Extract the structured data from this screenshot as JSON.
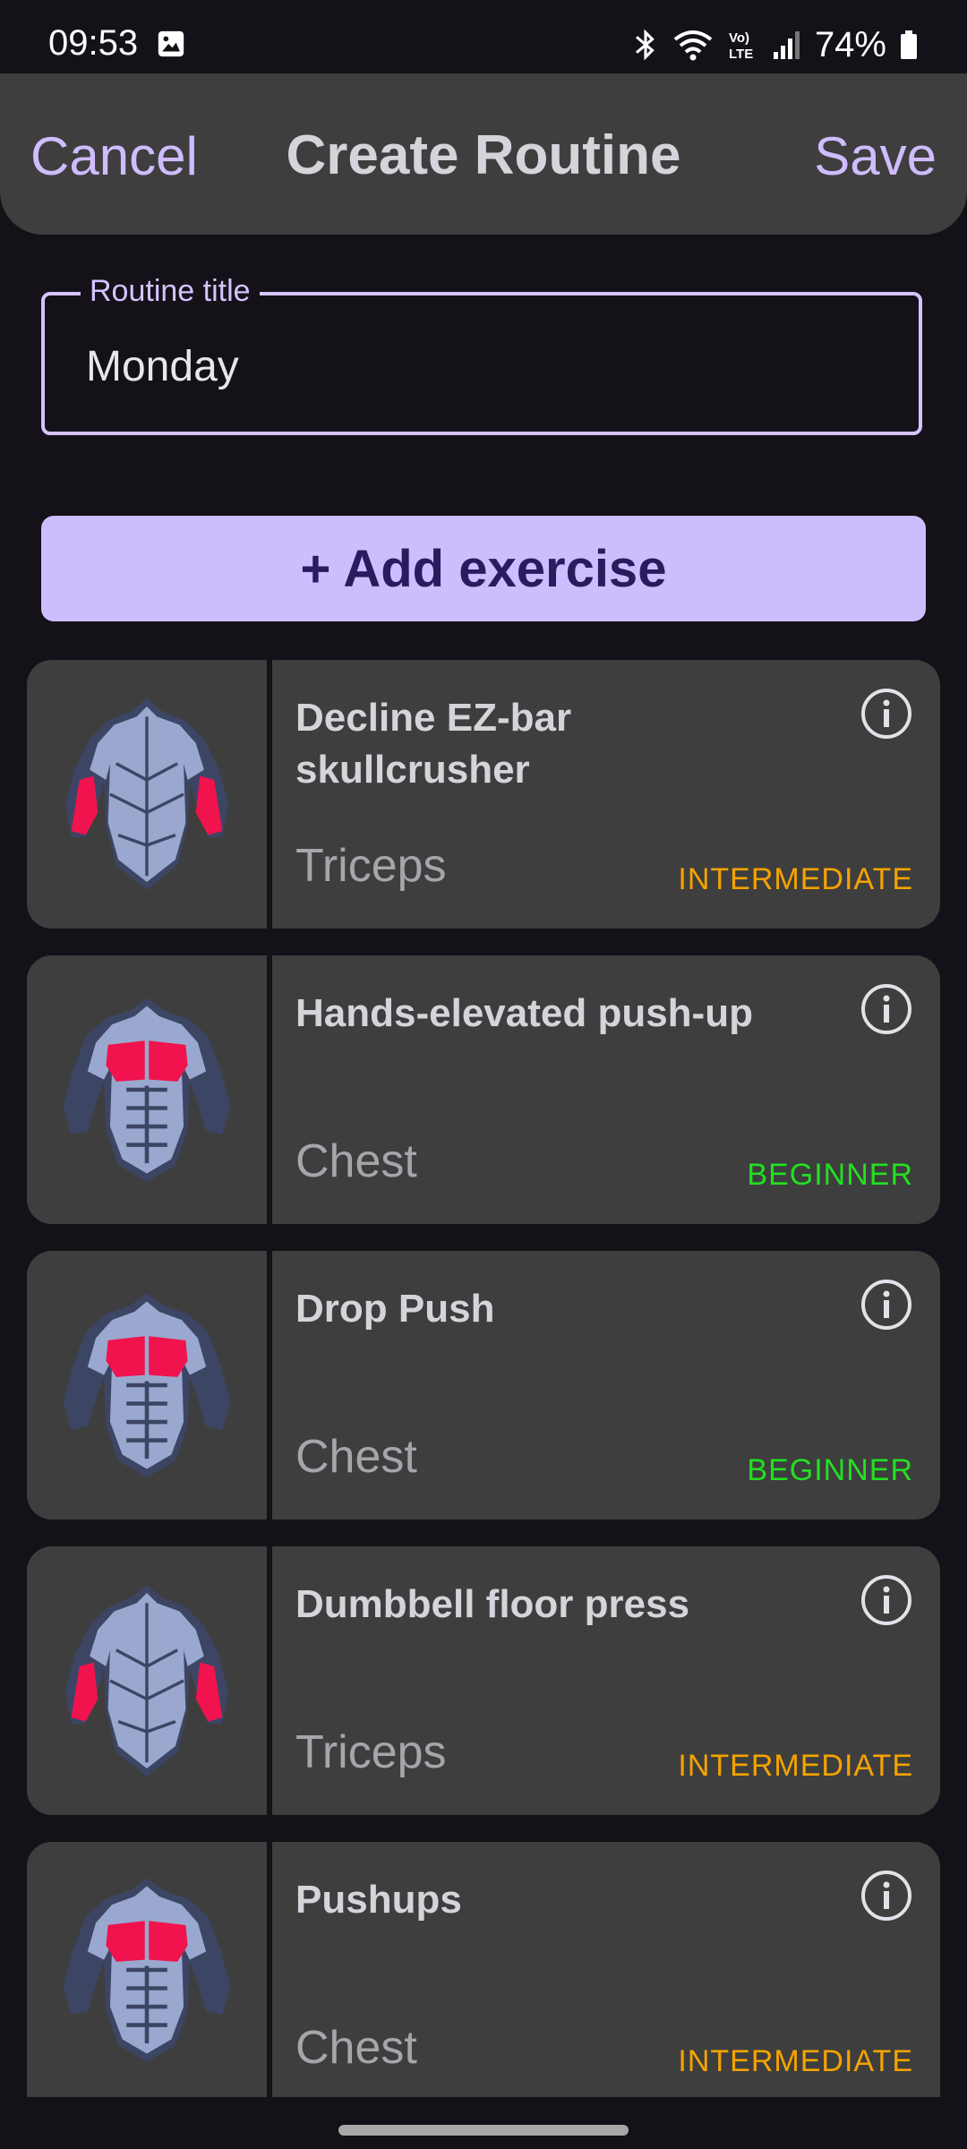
{
  "status_bar": {
    "time": "09:53",
    "battery": "74%",
    "icons": [
      "photo-icon",
      "bluetooth-icon",
      "wifi-icon",
      "volte-icon",
      "signal-icon",
      "battery-icon"
    ]
  },
  "appbar": {
    "cancel_label": "Cancel",
    "title": "Create Routine",
    "save_label": "Save"
  },
  "routine_field": {
    "label": "Routine title",
    "value": "Monday"
  },
  "add_button": {
    "label": "+ Add exercise"
  },
  "exercises": [
    {
      "name": "Decline EZ-bar skullcrusher",
      "muscle": "Triceps",
      "level": "INTERMEDIATE",
      "image": "back-triceps-icon"
    },
    {
      "name": "Hands-elevated push-up",
      "muscle": "Chest",
      "level": "BEGINNER",
      "image": "front-chest-icon"
    },
    {
      "name": "Drop Push",
      "muscle": "Chest",
      "level": "BEGINNER",
      "image": "front-chest-icon"
    },
    {
      "name": "Dumbbell floor press",
      "muscle": "Triceps",
      "level": "INTERMEDIATE",
      "image": "back-triceps-icon"
    },
    {
      "name": "Pushups",
      "muscle": "Chest",
      "level": "INTERMEDIATE",
      "image": "front-chest-icon"
    }
  ],
  "colors": {
    "accent": "#cfbcff",
    "intermediate": "#f5a300",
    "beginner": "#22e022",
    "highlight_muscle": "#f0134d"
  }
}
